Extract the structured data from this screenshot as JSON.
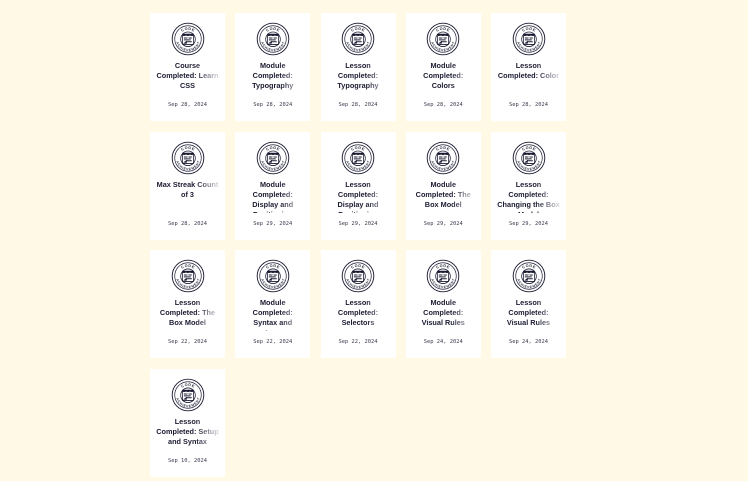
{
  "badge": {
    "icon": "code-achievement-badge-icon",
    "top_text": "CODE",
    "bottom_text": "ACHIEVEMENT"
  },
  "colors": {
    "page_background": "#fff9e6",
    "card_background": "#ffffff",
    "text": "#1b1b32"
  },
  "cards": [
    {
      "title": "Course Completed: Learn CSS",
      "date": "Sep 28, 2024"
    },
    {
      "title": "Module Completed: Typography",
      "date": "Sep 28, 2024"
    },
    {
      "title": "Lesson Completed: Typography",
      "date": "Sep 28, 2024"
    },
    {
      "title": "Module Completed: Colors",
      "date": "Sep 28, 2024"
    },
    {
      "title": "Lesson Completed: Color",
      "date": "Sep 28, 2024"
    },
    {
      "title": "Max Streak Count of 3",
      "date": "Sep 28, 2024"
    },
    {
      "title": "Module Completed: Display and Positioning",
      "date": "Sep 29, 2024"
    },
    {
      "title": "Lesson Completed: Display and Positioning",
      "date": "Sep 29, 2024"
    },
    {
      "title": "Module Completed: The Box Model",
      "date": "Sep 29, 2024"
    },
    {
      "title": "Lesson Completed: Changing the Box Model",
      "date": "Sep 29, 2024"
    },
    {
      "title": "Lesson Completed: The Box Model",
      "date": "Sep 22, 2024"
    },
    {
      "title": "Module Completed: Syntax and Selectors",
      "date": "Sep 22, 2024"
    },
    {
      "title": "Lesson Completed: Selectors",
      "date": "Sep 22, 2024"
    },
    {
      "title": "Module Completed: Visual Rules",
      "date": "Sep 24, 2024"
    },
    {
      "title": "Lesson Completed: Visual Rules",
      "date": "Sep 24, 2024"
    },
    {
      "title": "Lesson Completed: Setup and Syntax",
      "date": "Sep 10, 2024"
    }
  ]
}
